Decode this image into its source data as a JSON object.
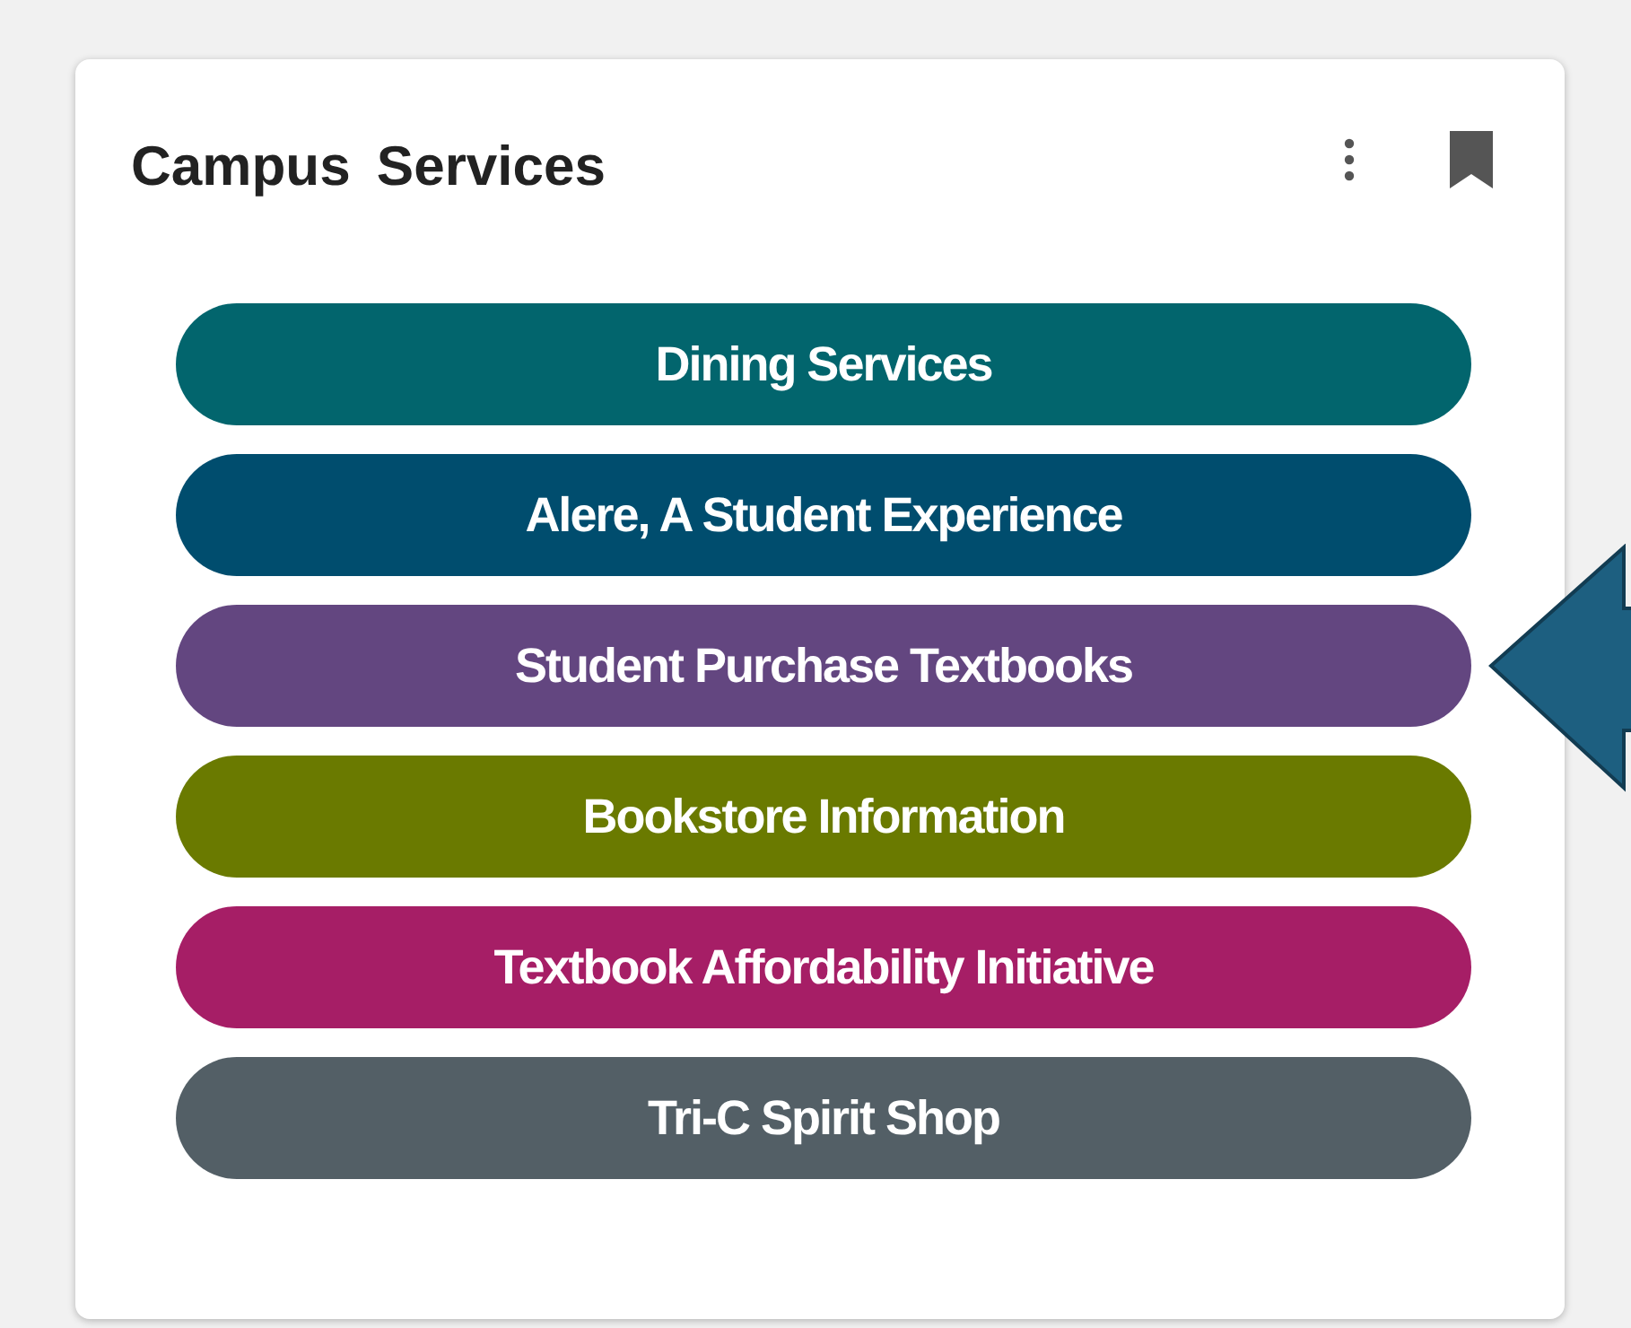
{
  "card": {
    "title": "Campus Services"
  },
  "buttons": [
    {
      "label": "Dining Services",
      "color": "#02656d"
    },
    {
      "label": "Alere, A Student Experience",
      "color": "#004d6e"
    },
    {
      "label": "Student Purchase Textbooks",
      "color": "#634680"
    },
    {
      "label": "Bookstore Information",
      "color": "#6a7a00"
    },
    {
      "label": "Textbook Affordability Initiative",
      "color": "#a61e66"
    },
    {
      "label": "Tri-C Spirit Shop",
      "color": "#535f66"
    }
  ]
}
